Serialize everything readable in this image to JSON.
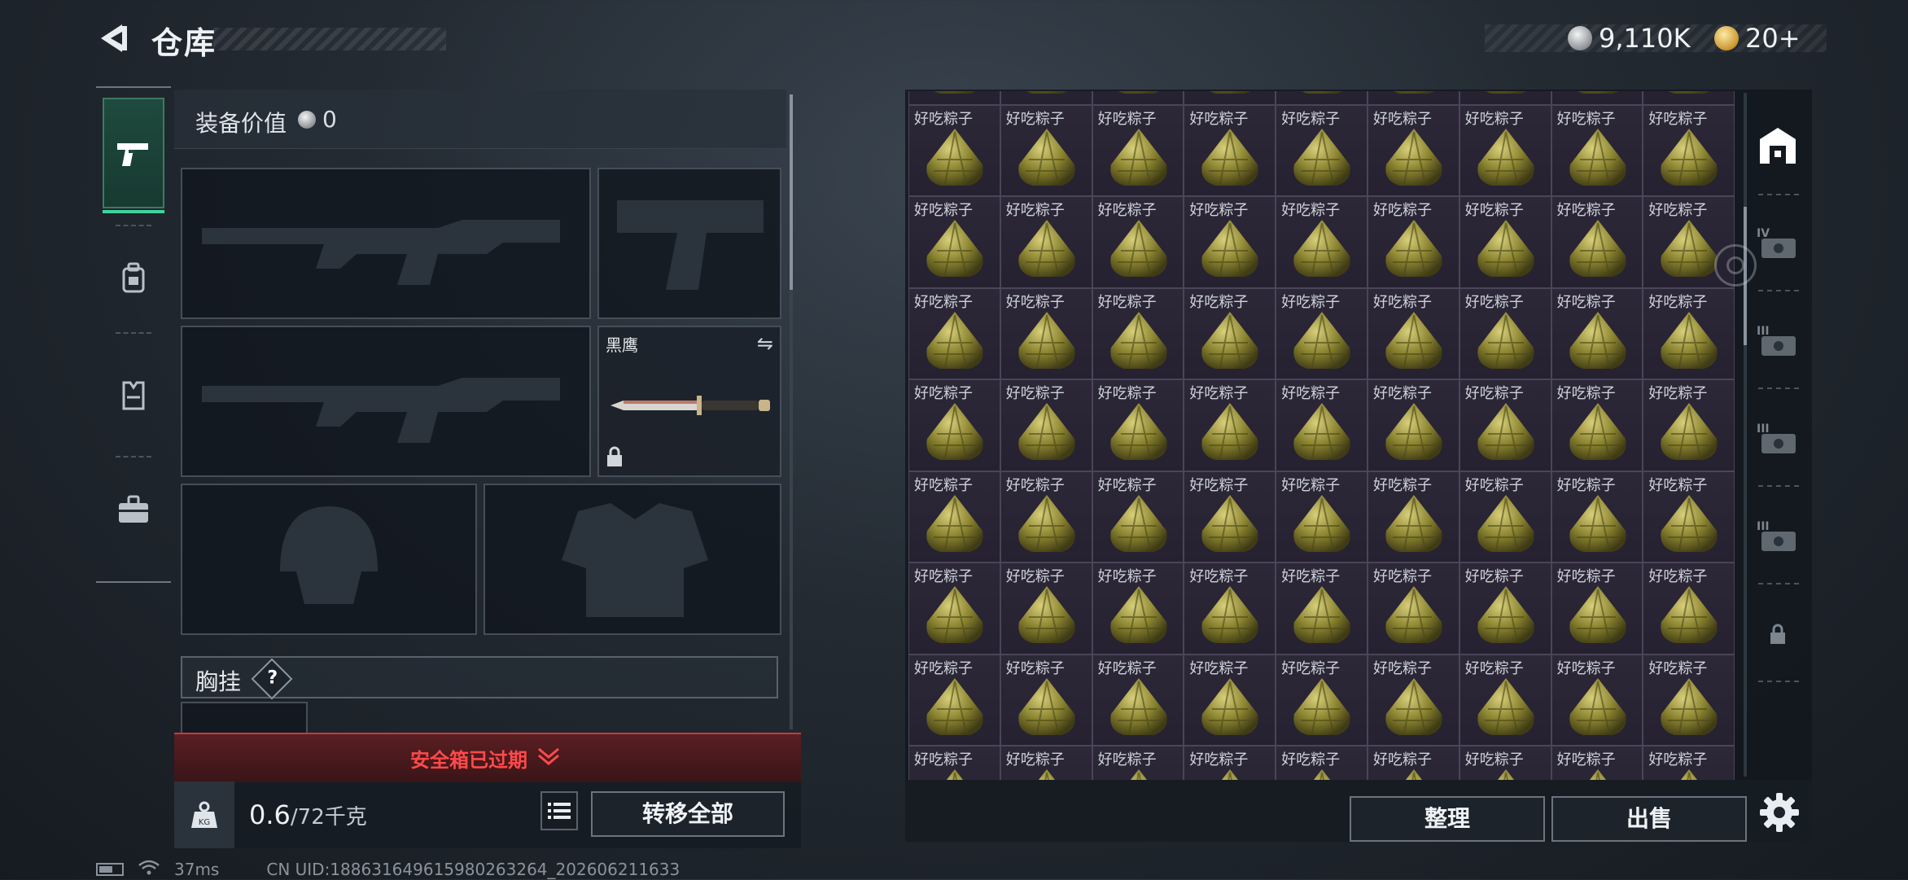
{
  "header": {
    "title": "仓库"
  },
  "currency": {
    "silver": "9,110K",
    "gold": "20+"
  },
  "categories": [
    {
      "name": "weapons",
      "icon": "pistol-icon",
      "active": true
    },
    {
      "name": "backpack",
      "icon": "backpack-icon",
      "active": false
    },
    {
      "name": "chest-rig",
      "icon": "vest-icon",
      "active": false
    },
    {
      "name": "medkit",
      "icon": "briefcase-icon",
      "active": false
    }
  ],
  "equipment": {
    "value_label": "装备价值",
    "value": "0",
    "melee_name": "黑鹰",
    "chest_label": "胸挂",
    "help": "?",
    "expired_text": "安全箱已过期",
    "weight_current": "0.6",
    "weight_max": "/72千克",
    "transfer_label": "转移全部"
  },
  "warehouse": {
    "item_name": "好吃粽子",
    "columns": 9,
    "rows_visible": 9,
    "sort_label": "整理",
    "sell_label": "出售"
  },
  "side_tabs": [
    {
      "icon": "warehouse-icon",
      "label": ""
    },
    {
      "icon": "case-tier-4-icon",
      "label": "IV"
    },
    {
      "icon": "case-tier-3-icon",
      "label": "III"
    },
    {
      "icon": "case-tier-3-icon",
      "label": "III"
    },
    {
      "icon": "case-tier-3-icon",
      "label": "III"
    },
    {
      "icon": "lock-icon",
      "label": ""
    }
  ],
  "status": {
    "ping": "37ms",
    "uid": "CN UID:1886316496159802632​64_202606211633"
  },
  "colors": {
    "accent_green": "#3fd39b",
    "expired_red": "#ff4a4a",
    "cell_purple": "#2d2838"
  }
}
